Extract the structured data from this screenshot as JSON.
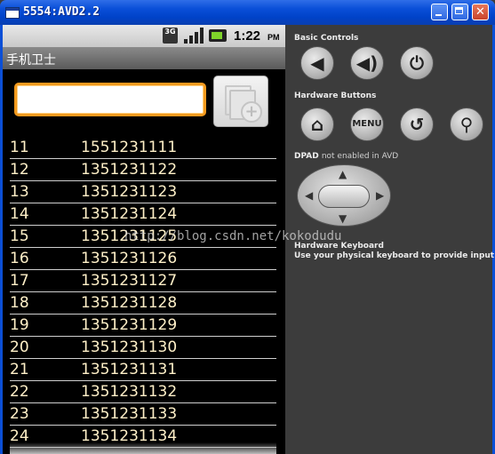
{
  "window": {
    "title": "5554:AVD2.2"
  },
  "statusbar": {
    "network": "3G",
    "time": "1:22",
    "ampm": "PM"
  },
  "app": {
    "title": "手机卫士"
  },
  "number_input": {
    "value": ""
  },
  "rows": [
    {
      "id": "11",
      "phone": "1551231111"
    },
    {
      "id": "12",
      "phone": "1351231122"
    },
    {
      "id": "13",
      "phone": "1351231123"
    },
    {
      "id": "14",
      "phone": "1351231124"
    },
    {
      "id": "15",
      "phone": "1351231125"
    },
    {
      "id": "16",
      "phone": "1351231126"
    },
    {
      "id": "17",
      "phone": "1351231127"
    },
    {
      "id": "18",
      "phone": "1351231128"
    },
    {
      "id": "19",
      "phone": "1351231129"
    },
    {
      "id": "20",
      "phone": "1351231130"
    },
    {
      "id": "21",
      "phone": "1351231131"
    },
    {
      "id": "22",
      "phone": "1351231132"
    },
    {
      "id": "23",
      "phone": "1351231133"
    },
    {
      "id": "24",
      "phone": "1351231134"
    }
  ],
  "watermark": "http://blog.csdn.net/kokodudu",
  "controls": {
    "basic_label": "Basic Controls",
    "hardware_label": "Hardware Buttons",
    "menu_label": "MENU",
    "dpad_label": "DPAD",
    "dpad_note": "not enabled in AVD",
    "keyboard_title": "Hardware Keyboard",
    "keyboard_note": "Use your physical keyboard to provide input"
  },
  "colors": {
    "accent": "#f39a1e",
    "titlebar": "#0a4fd8",
    "list_text": "#fff0c8"
  }
}
